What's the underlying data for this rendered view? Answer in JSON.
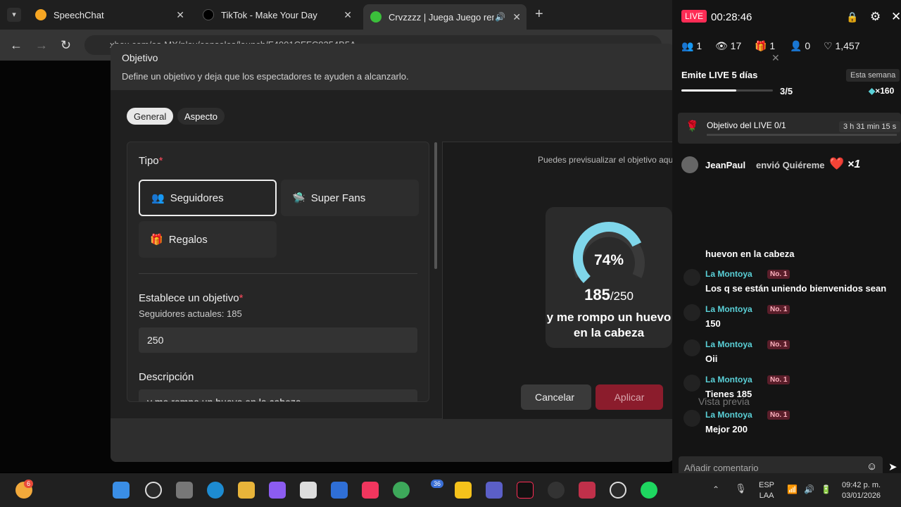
{
  "browser": {
    "tabs": [
      {
        "title": "SpeechChat",
        "color": "#f6a623"
      },
      {
        "title": "TikTok - Make Your Day",
        "color": "#000000"
      },
      {
        "title": "Crvzzzz | Juega Juego remo",
        "color": "#3bbf3b"
      }
    ],
    "url": "xbox.com/es-MX/play/consoles/launch/F4001CFFC8354B5A"
  },
  "dialog": {
    "title": "Objetivo",
    "subtitle": "Define un objetivo y deja que los espectadores te ayuden a alcanzarlo.",
    "tabs": {
      "general": "General",
      "aspecto": "Aspecto"
    },
    "tipo_label": "Tipo",
    "options": {
      "seguidores": "Seguidores",
      "superfans": "Super Fans",
      "regalos": "Regalos"
    },
    "objetivo_label": "Establece un objetivo",
    "current_followers": "Seguidores actuales: 185",
    "objetivo_value": "250",
    "descripcion_label": "Descripción",
    "descripcion_value": "y me rompo un huevo en la cabeza",
    "preview_hint": "Puedes previsualizar el objetivo aquí",
    "goal": {
      "percent": "74%",
      "current": "185",
      "target": "/250",
      "desc": "y me rompo un huevo en la cabeza",
      "fill_fraction": 0.74
    },
    "cancel": "Cancelar",
    "apply": "Aplicar",
    "vista_previa": "Vista previa"
  },
  "live": {
    "badge": "LIVE",
    "timer": "00:28:46",
    "stats": {
      "users": "1",
      "views": "17",
      "gifts": "1",
      "follows": "0",
      "likes": "1,457"
    },
    "emite": "Emite LIVE 5 días",
    "semana": "Esta semana",
    "progress": "3/5",
    "gems": "×160",
    "objetivo": "Objetivo del LIVE 0/1",
    "objetivo_time": "3 h 31 min 15 s",
    "gift": {
      "user": "JeanPaul",
      "action": "envió Quiéreme",
      "count": "×1"
    },
    "chat_top": "huevon en la cabeza",
    "chat": [
      {
        "user": "La Montoya",
        "badge": "No. 1",
        "msg": "Los q se están uniendo bienvenidos sean"
      },
      {
        "user": "La Montoya",
        "badge": "No. 1",
        "msg": "150"
      },
      {
        "user": "La Montoya",
        "badge": "No. 1",
        "msg": "Oii"
      },
      {
        "user": "La Montoya",
        "badge": "No. 1",
        "msg": "Tienes 185"
      },
      {
        "user": "La Montoya",
        "badge": "No. 1",
        "msg": "Mejor 200"
      }
    ],
    "comment_placeholder": "Añadir comentario"
  },
  "taskbar": {
    "lang1": "ESP",
    "lang2": "LAA",
    "time": "09:42 p. m.",
    "date": "03/01/2026",
    "weather_badge": "6",
    "chrome_badge": "36"
  }
}
